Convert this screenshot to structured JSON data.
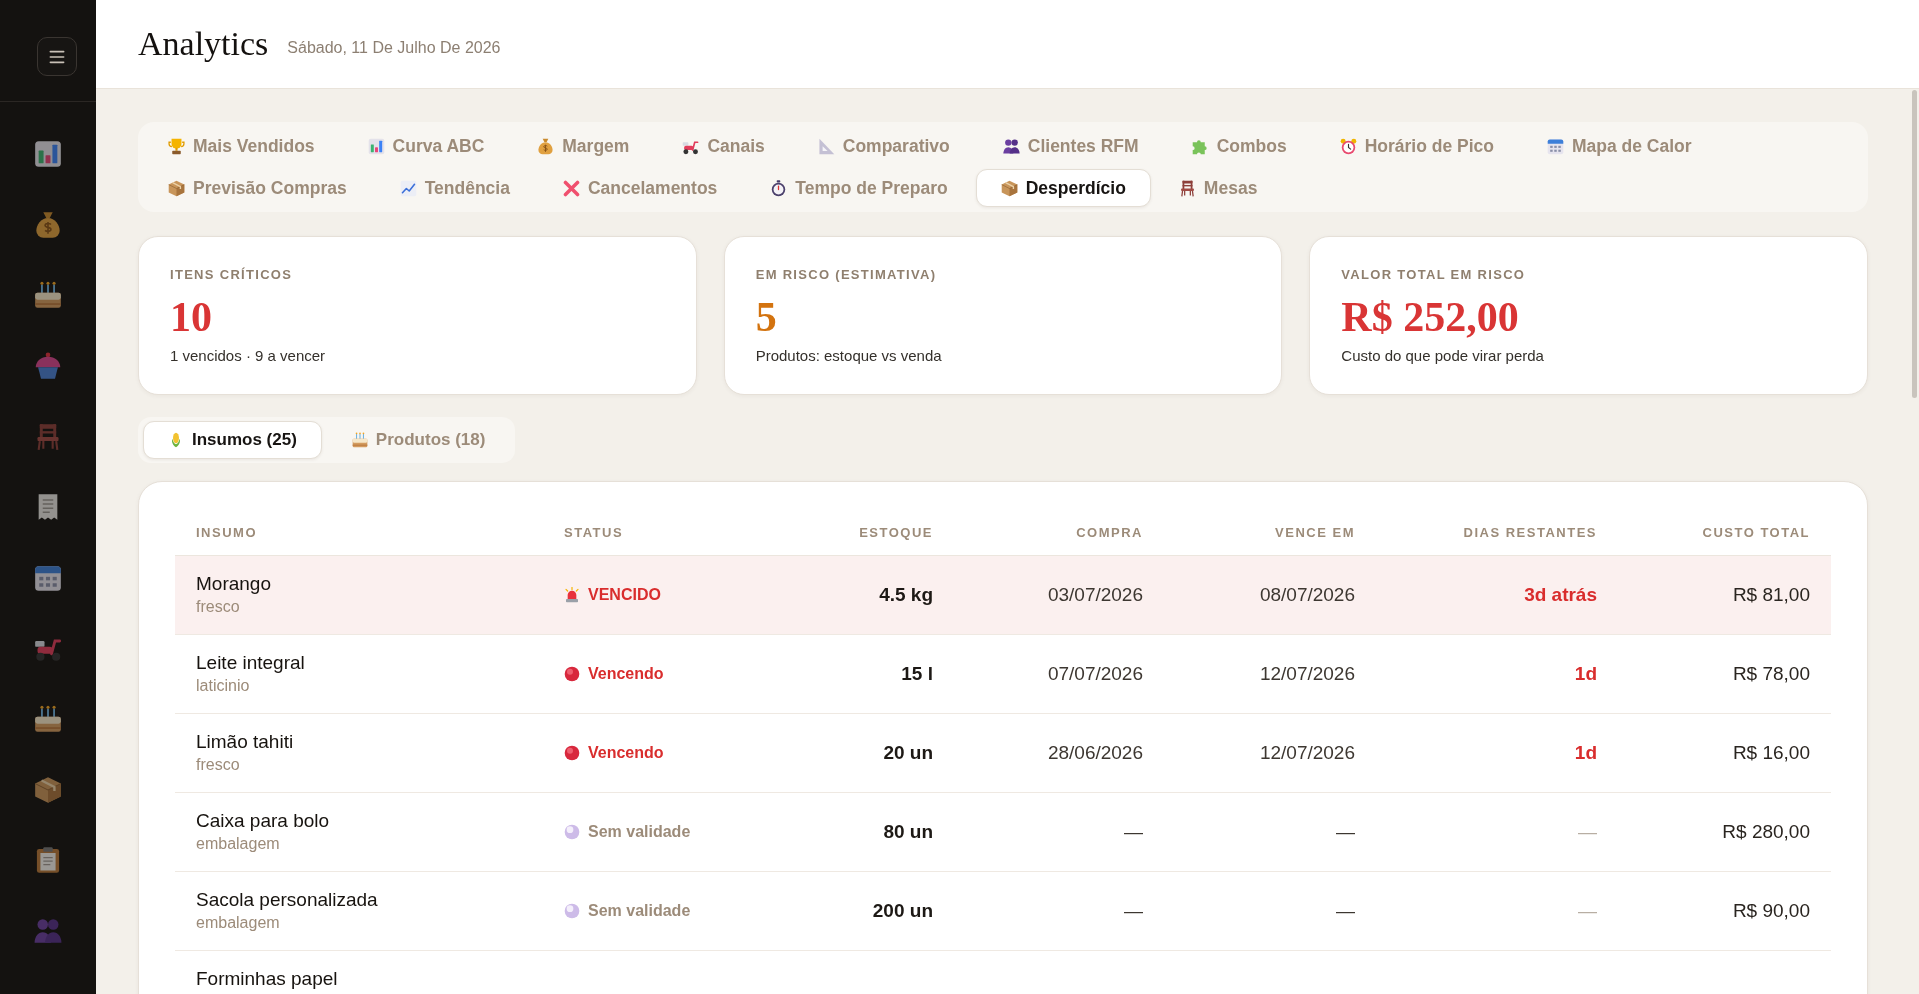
{
  "header": {
    "title": "Analytics",
    "date": "Sábado, 11 De Julho De 2026"
  },
  "report_tabs": [
    {
      "label": "Mais Vendidos",
      "selected": false
    },
    {
      "label": "Curva ABC",
      "selected": false
    },
    {
      "label": "Margem",
      "selected": false
    },
    {
      "label": "Canais",
      "selected": false
    },
    {
      "label": "Comparativo",
      "selected": false
    },
    {
      "label": "Clientes RFM",
      "selected": false
    },
    {
      "label": "Combos",
      "selected": false
    },
    {
      "label": "Horário de Pico",
      "selected": false
    },
    {
      "label": "Mapa de Calor",
      "selected": false
    },
    {
      "label": "Previsão Compras",
      "selected": false
    },
    {
      "label": "Tendência",
      "selected": false
    },
    {
      "label": "Cancelamentos",
      "selected": false
    },
    {
      "label": "Tempo de Preparo",
      "selected": false
    },
    {
      "label": "Desperdício",
      "selected": true
    },
    {
      "label": "Mesas",
      "selected": false
    }
  ],
  "kpi_cards": [
    {
      "label": "ITENS CRÍTICOS",
      "value": "10",
      "color": "#d93535",
      "caption": "1 vencidos · 9 a vencer"
    },
    {
      "label": "EM RISCO (ESTIMATIVA)",
      "value": "5",
      "color": "#d3730f",
      "caption": "Produtos: estoque vs venda"
    },
    {
      "label": "VALOR TOTAL EM RISCO",
      "value": "R$ 252,00",
      "color": "#d93535",
      "caption": "Custo do que pode virar perda"
    }
  ],
  "list_tabs": [
    {
      "label": "Insumos (25)",
      "selected": true
    },
    {
      "label": "Produtos (18)",
      "selected": false
    }
  ],
  "table": {
    "columns": [
      "INSUMO",
      "STATUS",
      "ESTOQUE",
      "COMPRA",
      "VENCE EM",
      "DIAS RESTANTES",
      "CUSTO TOTAL"
    ],
    "rows": [
      {
        "name": "Morango",
        "category": "fresco",
        "status": {
          "kind": "expired",
          "label": "VENCIDO"
        },
        "stock": "4.5 kg",
        "purchase": "03/07/2026",
        "expires": "08/07/2026",
        "days_left": "3d atrás",
        "total_cost": "R$ 81,00"
      },
      {
        "name": "Leite integral",
        "category": "laticinio",
        "status": {
          "kind": "expiring",
          "label": "Vencendo"
        },
        "stock": "15 l",
        "purchase": "07/07/2026",
        "expires": "12/07/2026",
        "days_left": "1d",
        "total_cost": "R$ 78,00"
      },
      {
        "name": "Limão tahiti",
        "category": "fresco",
        "status": {
          "kind": "expiring",
          "label": "Vencendo"
        },
        "stock": "20 un",
        "purchase": "28/06/2026",
        "expires": "12/07/2026",
        "days_left": "1d",
        "total_cost": "R$ 16,00"
      },
      {
        "name": "Caixa para bolo",
        "category": "embalagem",
        "status": {
          "kind": "none",
          "label": "Sem validade"
        },
        "stock": "80 un",
        "purchase": "—",
        "expires": "—",
        "days_left": "—",
        "total_cost": "R$ 280,00"
      },
      {
        "name": "Sacola personalizada",
        "category": "embalagem",
        "status": {
          "kind": "none",
          "label": "Sem validade"
        },
        "stock": "200 un",
        "purchase": "—",
        "expires": "—",
        "days_left": "—",
        "total_cost": "R$ 90,00"
      },
      {
        "name": "Forminhas papel"
      }
    ]
  }
}
